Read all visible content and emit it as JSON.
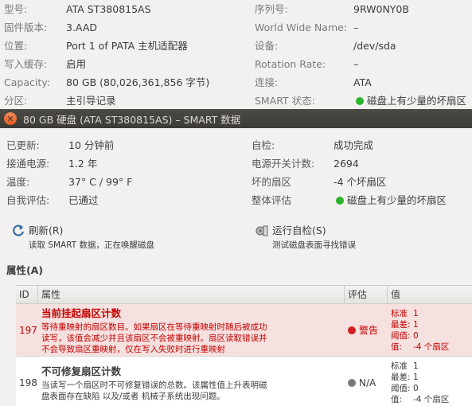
{
  "background": {
    "left_rows": [
      {
        "label": "型号:",
        "value": "ATA ST380815AS"
      },
      {
        "label": "固件版本:",
        "value": "3.AAD"
      },
      {
        "label": "位置:",
        "value": "Port 1 of PATA 主机适配器"
      },
      {
        "label": "写入缓存:",
        "value": "启用"
      },
      {
        "label": "Capacity:",
        "value": "80 GB (80,026,361,856 字节)"
      },
      {
        "label": "分区:",
        "value": "主引导记录"
      }
    ],
    "right_rows": [
      {
        "label": "序列号:",
        "value": "9RW0NY0B"
      },
      {
        "label": "World Wide Name:",
        "value": "–"
      },
      {
        "label": "设备:",
        "value": "/dev/sda"
      },
      {
        "label": "Rotation Rate:",
        "value": "–"
      },
      {
        "label": "连接:",
        "value": "ATA"
      },
      {
        "label": "SMART 状态:",
        "value": "磁盘上有少量的坏扇区",
        "status_color": "#2cb32c"
      }
    ]
  },
  "dialog": {
    "title": "80 GB 硬盘 (ATA ST380815AS) – SMART 数据",
    "info_left": [
      {
        "label": "已更新:",
        "value": "10 分钟前"
      },
      {
        "label": "接通电源:",
        "value": "1.2 年"
      },
      {
        "label": "温度:",
        "value": "37° C / 99° F"
      },
      {
        "label": "自我评估:",
        "value": "已通过"
      }
    ],
    "info_right": [
      {
        "label": "自检:",
        "value": "成功完成"
      },
      {
        "label": "电源开关计数:",
        "value": "2694"
      },
      {
        "label": "坏的扇区",
        "value": "-4 个坏扇区"
      },
      {
        "label": "整体评估",
        "value": "磁盘上有少量的坏扇区",
        "status_color": "#2cb32c"
      }
    ],
    "actions": {
      "refresh": {
        "title": "刷新(R)",
        "desc": "读取 SMART 数据，正在唤醒磁盘",
        "icon": "refresh-icon"
      },
      "selftest": {
        "title": "运行自检(S)",
        "desc": "测试磁盘表面寻找错误",
        "icon": "selftest-icon"
      }
    },
    "attributes_title": "属性(A)",
    "table": {
      "headers": {
        "id": "ID",
        "attr": "属性",
        "eval": "评估",
        "val": "值"
      },
      "rows": [
        {
          "id": "197",
          "title": "当前挂起扇区计数",
          "desc": [
            "等待重映射的扇区数目。如果扇区在等待重映射时随后被成功",
            "读写，该值会减少并且该扇区不会被重映射。扇区读取错误并",
            "不会导致扇区重映射，仅在写入失败时进行重映射"
          ],
          "eval": "警告",
          "eval_color": "#d01e1e",
          "values": [
            {
              "k": "标准",
              "v": "1"
            },
            {
              "k": "最差:",
              "v": "1"
            },
            {
              "k": "阈值:",
              "v": "0"
            },
            {
              "k": "值:",
              "v": "-4 个扇区"
            }
          ]
        },
        {
          "id": "198",
          "title": "不可修复扇区计数",
          "desc": [
            "当读写一个扇区时不可修复错误的总数。该属性值上升表明磁",
            "盘表面存在缺陷 以及/或者 机械子系统出现问题。"
          ],
          "eval": "N/A",
          "eval_color": "#7a7a7a",
          "values": [
            {
              "k": "标准",
              "v": "1"
            },
            {
              "k": "最差:",
              "v": "1"
            },
            {
              "k": "阈值:",
              "v": "0"
            },
            {
              "k": "值:",
              "v": "-4 个扇区"
            }
          ]
        }
      ]
    }
  }
}
